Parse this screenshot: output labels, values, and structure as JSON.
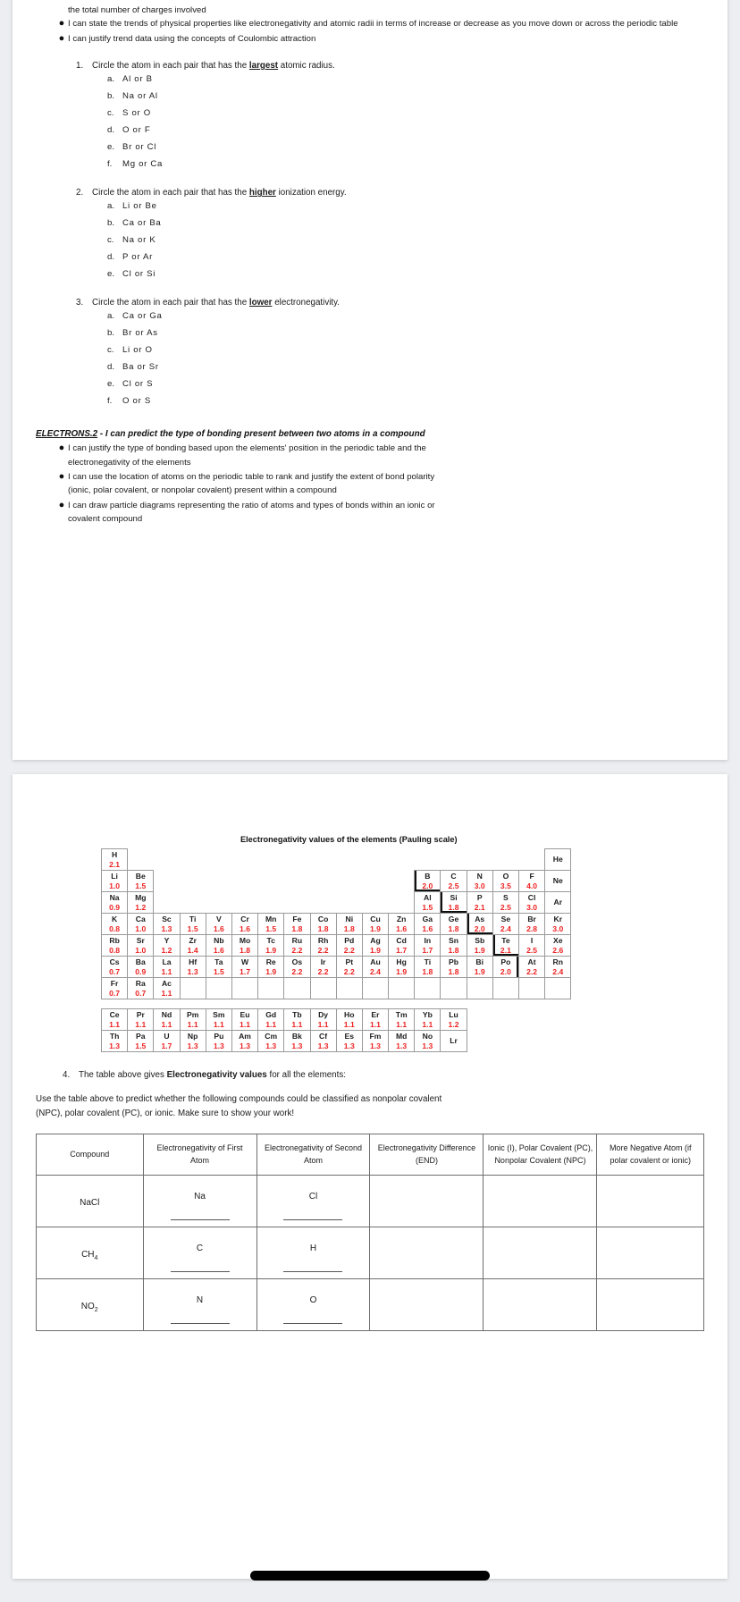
{
  "page_one": {
    "partial_top_line": "the total number of charges involved",
    "objectives": [
      "I can state the trends of physical properties like electronegativity and atomic radii in terms of increase or decrease as you move down or across the periodic table",
      "I can justify trend data using the concepts of Coulombic attraction"
    ],
    "questions": [
      {
        "number": "1.",
        "prompt_before": "Circle the atom in each pair that has the ",
        "emphasis": "largest",
        "prompt_after": " atomic radius.",
        "items": [
          {
            "letter": "a.",
            "pair": "Al  or  B"
          },
          {
            "letter": "b.",
            "pair": "Na or Al"
          },
          {
            "letter": "c.",
            "pair": "S or O"
          },
          {
            "letter": "d.",
            "pair": "O or F"
          },
          {
            "letter": "e.",
            "pair": "Br  or  Cl"
          },
          {
            "letter": "f.",
            "pair": "Mg  or  Ca"
          }
        ]
      },
      {
        "number": "2.",
        "prompt_before": "Circle the atom in each pair that has the ",
        "emphasis": "higher",
        "prompt_after": " ionization energy.",
        "items": [
          {
            "letter": "a.",
            "pair": "Li  or  Be"
          },
          {
            "letter": "b.",
            "pair": "Ca  or  Ba"
          },
          {
            "letter": "c.",
            "pair": "Na  or  K"
          },
          {
            "letter": "d.",
            "pair": "P  or  Ar"
          },
          {
            "letter": "e.",
            "pair": "Cl  or  Si"
          }
        ]
      },
      {
        "number": "3.",
        "prompt_before": "Circle the atom in each pair that has the ",
        "emphasis": "lower",
        "prompt_after": " electronegativity.",
        "items": [
          {
            "letter": "a.",
            "pair": "Ca  or  Ga"
          },
          {
            "letter": "b.",
            "pair": "Br  or  As"
          },
          {
            "letter": "c.",
            "pair": "Li or O"
          },
          {
            "letter": "d.",
            "pair": "Ba  or  Sr"
          },
          {
            "letter": "e.",
            "pair": "Cl or S"
          },
          {
            "letter": "f.",
            "pair": "O or S"
          }
        ]
      }
    ],
    "section": {
      "code": "ELECTRONS.2",
      "dash_title": " - I can predict the type of bonding present between two atoms in a compound",
      "bullets": [
        {
          "line1": "I can justify the type of bonding based upon the elements' position in the periodic table and the",
          "line2": "electronegativity of the elements"
        },
        {
          "line1": "I can use the location of atoms on the periodic table to rank and justify the extent of bond polarity",
          "line2": "(ionic, polar covalent, or nonpolar covalent)  present within a compound"
        },
        {
          "line1": "I can draw particle diagrams representing the ratio of atoms and types of bonds within an ionic or",
          "line2": "covalent compound"
        }
      ]
    }
  },
  "page_two": {
    "periodic_table": {
      "title": "Electronegativity values of the elements (Pauling scale)",
      "symbol_color": "#1c1c1c",
      "value_color": "#ee2222",
      "rows": [
        [
          {
            "sym": "H",
            "val": "2.1"
          },
          null,
          null,
          null,
          null,
          null,
          null,
          null,
          null,
          null,
          null,
          null,
          null,
          null,
          null,
          null,
          null,
          {
            "sym": "He",
            "val": ""
          }
        ],
        [
          {
            "sym": "Li",
            "val": "1.0"
          },
          {
            "sym": "Be",
            "val": "1.5"
          },
          null,
          null,
          null,
          null,
          null,
          null,
          null,
          null,
          null,
          null,
          {
            "sym": "B",
            "val": "2.0"
          },
          {
            "sym": "C",
            "val": "2.5"
          },
          {
            "sym": "N",
            "val": "3.0"
          },
          {
            "sym": "O",
            "val": "3.5"
          },
          {
            "sym": "F",
            "val": "4.0"
          },
          {
            "sym": "Ne",
            "val": ""
          }
        ],
        [
          {
            "sym": "Na",
            "val": "0.9"
          },
          {
            "sym": "Mg",
            "val": "1.2"
          },
          null,
          null,
          null,
          null,
          null,
          null,
          null,
          null,
          null,
          null,
          {
            "sym": "Al",
            "val": "1.5"
          },
          {
            "sym": "Si",
            "val": "1.8"
          },
          {
            "sym": "P",
            "val": "2.1"
          },
          {
            "sym": "S",
            "val": "2.5"
          },
          {
            "sym": "Cl",
            "val": "3.0"
          },
          {
            "sym": "Ar",
            "val": ""
          }
        ],
        [
          {
            "sym": "K",
            "val": "0.8"
          },
          {
            "sym": "Ca",
            "val": "1.0"
          },
          {
            "sym": "Sc",
            "val": "1.3"
          },
          {
            "sym": "Ti",
            "val": "1.5"
          },
          {
            "sym": "V",
            "val": "1.6"
          },
          {
            "sym": "Cr",
            "val": "1.6"
          },
          {
            "sym": "Mn",
            "val": "1.5"
          },
          {
            "sym": "Fe",
            "val": "1.8"
          },
          {
            "sym": "Co",
            "val": "1.8"
          },
          {
            "sym": "Ni",
            "val": "1.8"
          },
          {
            "sym": "Cu",
            "val": "1.9"
          },
          {
            "sym": "Zn",
            "val": "1.6"
          },
          {
            "sym": "Ga",
            "val": "1.6"
          },
          {
            "sym": "Ge",
            "val": "1.8"
          },
          {
            "sym": "As",
            "val": "2.0"
          },
          {
            "sym": "Se",
            "val": "2.4"
          },
          {
            "sym": "Br",
            "val": "2.8"
          },
          {
            "sym": "Kr",
            "val": "3.0"
          }
        ],
        [
          {
            "sym": "Rb",
            "val": "0.8"
          },
          {
            "sym": "Sr",
            "val": "1.0"
          },
          {
            "sym": "Y",
            "val": "1.2"
          },
          {
            "sym": "Zr",
            "val": "1.4"
          },
          {
            "sym": "Nb",
            "val": "1.6"
          },
          {
            "sym": "Mo",
            "val": "1.8"
          },
          {
            "sym": "Tc",
            "val": "1.9"
          },
          {
            "sym": "Ru",
            "val": "2.2"
          },
          {
            "sym": "Rh",
            "val": "2.2"
          },
          {
            "sym": "Pd",
            "val": "2.2"
          },
          {
            "sym": "Ag",
            "val": "1.9"
          },
          {
            "sym": "Cd",
            "val": "1.7"
          },
          {
            "sym": "In",
            "val": "1.7"
          },
          {
            "sym": "Sn",
            "val": "1.8"
          },
          {
            "sym": "Sb",
            "val": "1.9"
          },
          {
            "sym": "Te",
            "val": "2.1"
          },
          {
            "sym": "I",
            "val": "2.5"
          },
          {
            "sym": "Xe",
            "val": "2.6"
          }
        ],
        [
          {
            "sym": "Cs",
            "val": "0.7"
          },
          {
            "sym": "Ba",
            "val": "0.9"
          },
          {
            "sym": "La",
            "val": "1.1"
          },
          {
            "sym": "Hf",
            "val": "1.3"
          },
          {
            "sym": "Ta",
            "val": "1.5"
          },
          {
            "sym": "W",
            "val": "1.7"
          },
          {
            "sym": "Re",
            "val": "1.9"
          },
          {
            "sym": "Os",
            "val": "2.2"
          },
          {
            "sym": "Ir",
            "val": "2.2"
          },
          {
            "sym": "Pt",
            "val": "2.2"
          },
          {
            "sym": "Au",
            "val": "2.4"
          },
          {
            "sym": "Hg",
            "val": "1.9"
          },
          {
            "sym": "Ti",
            "val": "1.8"
          },
          {
            "sym": "Pb",
            "val": "1.8"
          },
          {
            "sym": "Bi",
            "val": "1.9"
          },
          {
            "sym": "Po",
            "val": "2.0"
          },
          {
            "sym": "At",
            "val": "2.2"
          },
          {
            "sym": "Rn",
            "val": "2.4"
          }
        ],
        [
          {
            "sym": "Fr",
            "val": "0.7"
          },
          {
            "sym": "Ra",
            "val": "0.7"
          },
          {
            "sym": "Ac",
            "val": "1.1"
          },
          {
            "sym": "",
            "val": ""
          },
          {
            "sym": "",
            "val": ""
          },
          {
            "sym": "",
            "val": ""
          },
          {
            "sym": "",
            "val": ""
          },
          {
            "sym": "",
            "val": ""
          },
          {
            "sym": "",
            "val": ""
          },
          {
            "sym": "",
            "val": ""
          },
          {
            "sym": "",
            "val": ""
          },
          {
            "sym": "",
            "val": ""
          },
          {
            "sym": "",
            "val": ""
          },
          {
            "sym": "",
            "val": ""
          },
          {
            "sym": "",
            "val": ""
          },
          {
            "sym": "",
            "val": ""
          },
          {
            "sym": "",
            "val": ""
          },
          {
            "sym": "",
            "val": ""
          }
        ]
      ],
      "lanthanides": [
        {
          "sym": "Ce",
          "val": "1.1"
        },
        {
          "sym": "Pr",
          "val": "1.1"
        },
        {
          "sym": "Nd",
          "val": "1.1"
        },
        {
          "sym": "Pm",
          "val": "1.1"
        },
        {
          "sym": "Sm",
          "val": "1.1"
        },
        {
          "sym": "Eu",
          "val": "1.1"
        },
        {
          "sym": "Gd",
          "val": "1.1"
        },
        {
          "sym": "Tb",
          "val": "1.1"
        },
        {
          "sym": "Dy",
          "val": "1.1"
        },
        {
          "sym": "Ho",
          "val": "1.1"
        },
        {
          "sym": "Er",
          "val": "1.1"
        },
        {
          "sym": "Tm",
          "val": "1.1"
        },
        {
          "sym": "Yb",
          "val": "1.1"
        },
        {
          "sym": "Lu",
          "val": "1.2"
        }
      ],
      "actinides": [
        {
          "sym": "Th",
          "val": "1.3"
        },
        {
          "sym": "Pa",
          "val": "1.5"
        },
        {
          "sym": "U",
          "val": "1.7"
        },
        {
          "sym": "Np",
          "val": "1.3"
        },
        {
          "sym": "Pu",
          "val": "1.3"
        },
        {
          "sym": "Am",
          "val": "1.3"
        },
        {
          "sym": "Cm",
          "val": "1.3"
        },
        {
          "sym": "Bk",
          "val": "1.3"
        },
        {
          "sym": "Cf",
          "val": "1.3"
        },
        {
          "sym": "Es",
          "val": "1.3"
        },
        {
          "sym": "Fm",
          "val": "1.3"
        },
        {
          "sym": "Md",
          "val": "1.3"
        },
        {
          "sym": "No",
          "val": "1.3"
        },
        {
          "sym": "Lr",
          "val": ""
        }
      ]
    },
    "question4": {
      "number": "4.",
      "before": "The table above gives ",
      "bold": "Electronegativity values",
      "after": " for all the elements:"
    },
    "instructions_line1": "Use the table above to predict whether the following compounds could be classified as nonpolar covalent",
    "instructions_line2": "(NPC), polar covalent (PC), or ionic.  Make sure to show your work!",
    "compound_table": {
      "headers": [
        "Compound",
        "Electronegativity of First Atom",
        "Electronegativity of Second Atom",
        "Electronegativity Difference (END)",
        "Ionic (I), Polar Covalent (PC), Nonpolar Covalent (NPC)",
        "More Negative Atom (if polar covalent or ionic)"
      ],
      "rows": [
        {
          "compound": "NaCl",
          "compound_sub": "",
          "first_atom": "Na",
          "second_atom": "Cl",
          "difference": "",
          "classification": "",
          "more_negative": ""
        },
        {
          "compound": "CH",
          "compound_sub": "4",
          "first_atom": "C",
          "second_atom": "H",
          "difference": "",
          "classification": "",
          "more_negative": ""
        },
        {
          "compound": "NO",
          "compound_sub": "2",
          "first_atom": "N",
          "second_atom": "O",
          "difference": "",
          "classification": "",
          "more_negative": ""
        }
      ]
    }
  }
}
